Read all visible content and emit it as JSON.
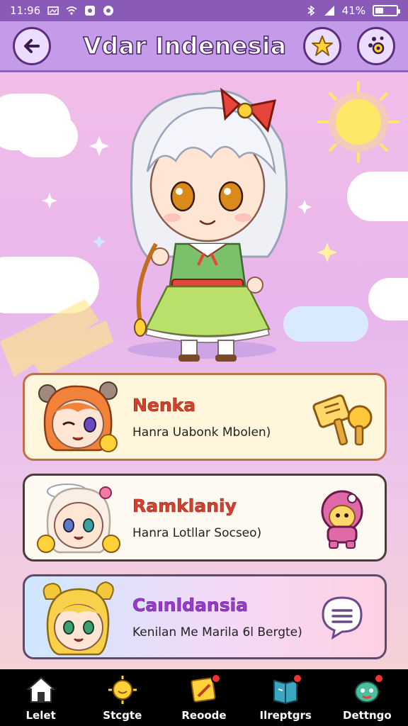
{
  "status_bar": {
    "time": "11:96",
    "carrier_icons": [
      "gallery-icon",
      "wifi-icon",
      "app-icon",
      "app2-icon"
    ],
    "battery_text": "41%",
    "battery_level": 0.41
  },
  "header": {
    "title": "Vdar Indenesia",
    "back_icon": "back-arrow-icon",
    "star_icon": "star-icon",
    "settings_icon": "dots-settings-icon"
  },
  "cards": [
    {
      "name": "Nenka",
      "subtitle": "Hanra Uabonk Mbolen)",
      "icon": "scroll-hammer-icon"
    },
    {
      "name": "Ramklaniy",
      "subtitle": "Hanra Lotllar Socseo)",
      "icon": "pink-creature-icon"
    },
    {
      "name": "Caınldansia",
      "subtitle": "Kenilan Me Marila 6l Bergte)",
      "icon": "chat-bubble-icon"
    }
  ],
  "nav": [
    {
      "label": "Lelet",
      "icon": "home-icon",
      "badge": false
    },
    {
      "label": "Stcgte",
      "icon": "sun-smile-icon",
      "badge": false
    },
    {
      "label": "Reoode",
      "icon": "note-icon",
      "badge": true
    },
    {
      "label": "Ilreptgrs",
      "icon": "book-icon",
      "badge": true
    },
    {
      "label": "Dettngo",
      "icon": "creature-icon",
      "badge": true
    }
  ],
  "colors": {
    "header_bg": "#c49be8",
    "accent_purple": "#8a5ab8",
    "card1_name": "#d8402e",
    "card3_name": "#9a3bd0"
  }
}
